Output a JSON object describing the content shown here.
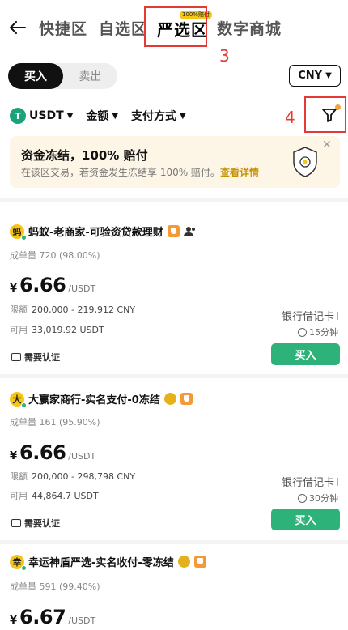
{
  "nav": {
    "tabs": [
      "快捷区",
      "自选区",
      "严选区",
      "数字商城"
    ],
    "active_tab_badge": "100%赔付"
  },
  "annotations": {
    "box3": "3",
    "box4": "4"
  },
  "trade_toggle": {
    "buy": "买入",
    "sell": "卖出"
  },
  "currency": {
    "selected": "CNY"
  },
  "filters": {
    "coin": "USDT",
    "amount": "金额",
    "payment": "支付方式"
  },
  "banner": {
    "title": "资金冻结，100% 赔付",
    "desc": "在该区交易，若资金发生冻结享 100% 赔付。",
    "link": "查看详情"
  },
  "listings": [
    {
      "avatar": "蚂",
      "name": "蚂蚁-老商家-可验资贷款理财",
      "stats": "成单量 720 (98.00%)",
      "currency_symbol": "¥",
      "price": "6.66",
      "unit": "/USDT",
      "limit_label": "限额",
      "limit": "200,000 - 219,912 CNY",
      "available_label": "可用",
      "available": "33,019.92 USDT",
      "verify": "需要认证",
      "payment": "银行借记卡",
      "time": "15分钟",
      "button": "买入"
    },
    {
      "avatar": "大",
      "name": "大赢家商行-实名支付-0冻结",
      "stats": "成单量 161 (95.90%)",
      "currency_symbol": "¥",
      "price": "6.66",
      "unit": "/USDT",
      "limit_label": "限额",
      "limit": "200,000 - 298,798 CNY",
      "available_label": "可用",
      "available": "44,864.7 USDT",
      "verify": "需要认证",
      "payment": "银行借记卡",
      "time": "30分钟",
      "button": "买入"
    },
    {
      "avatar": "幸",
      "name": "幸运神盾严选-实名收付-零冻结",
      "stats": "成单量 591 (99.40%)",
      "currency_symbol": "¥",
      "price": "6.67",
      "unit": "/USDT"
    }
  ]
}
